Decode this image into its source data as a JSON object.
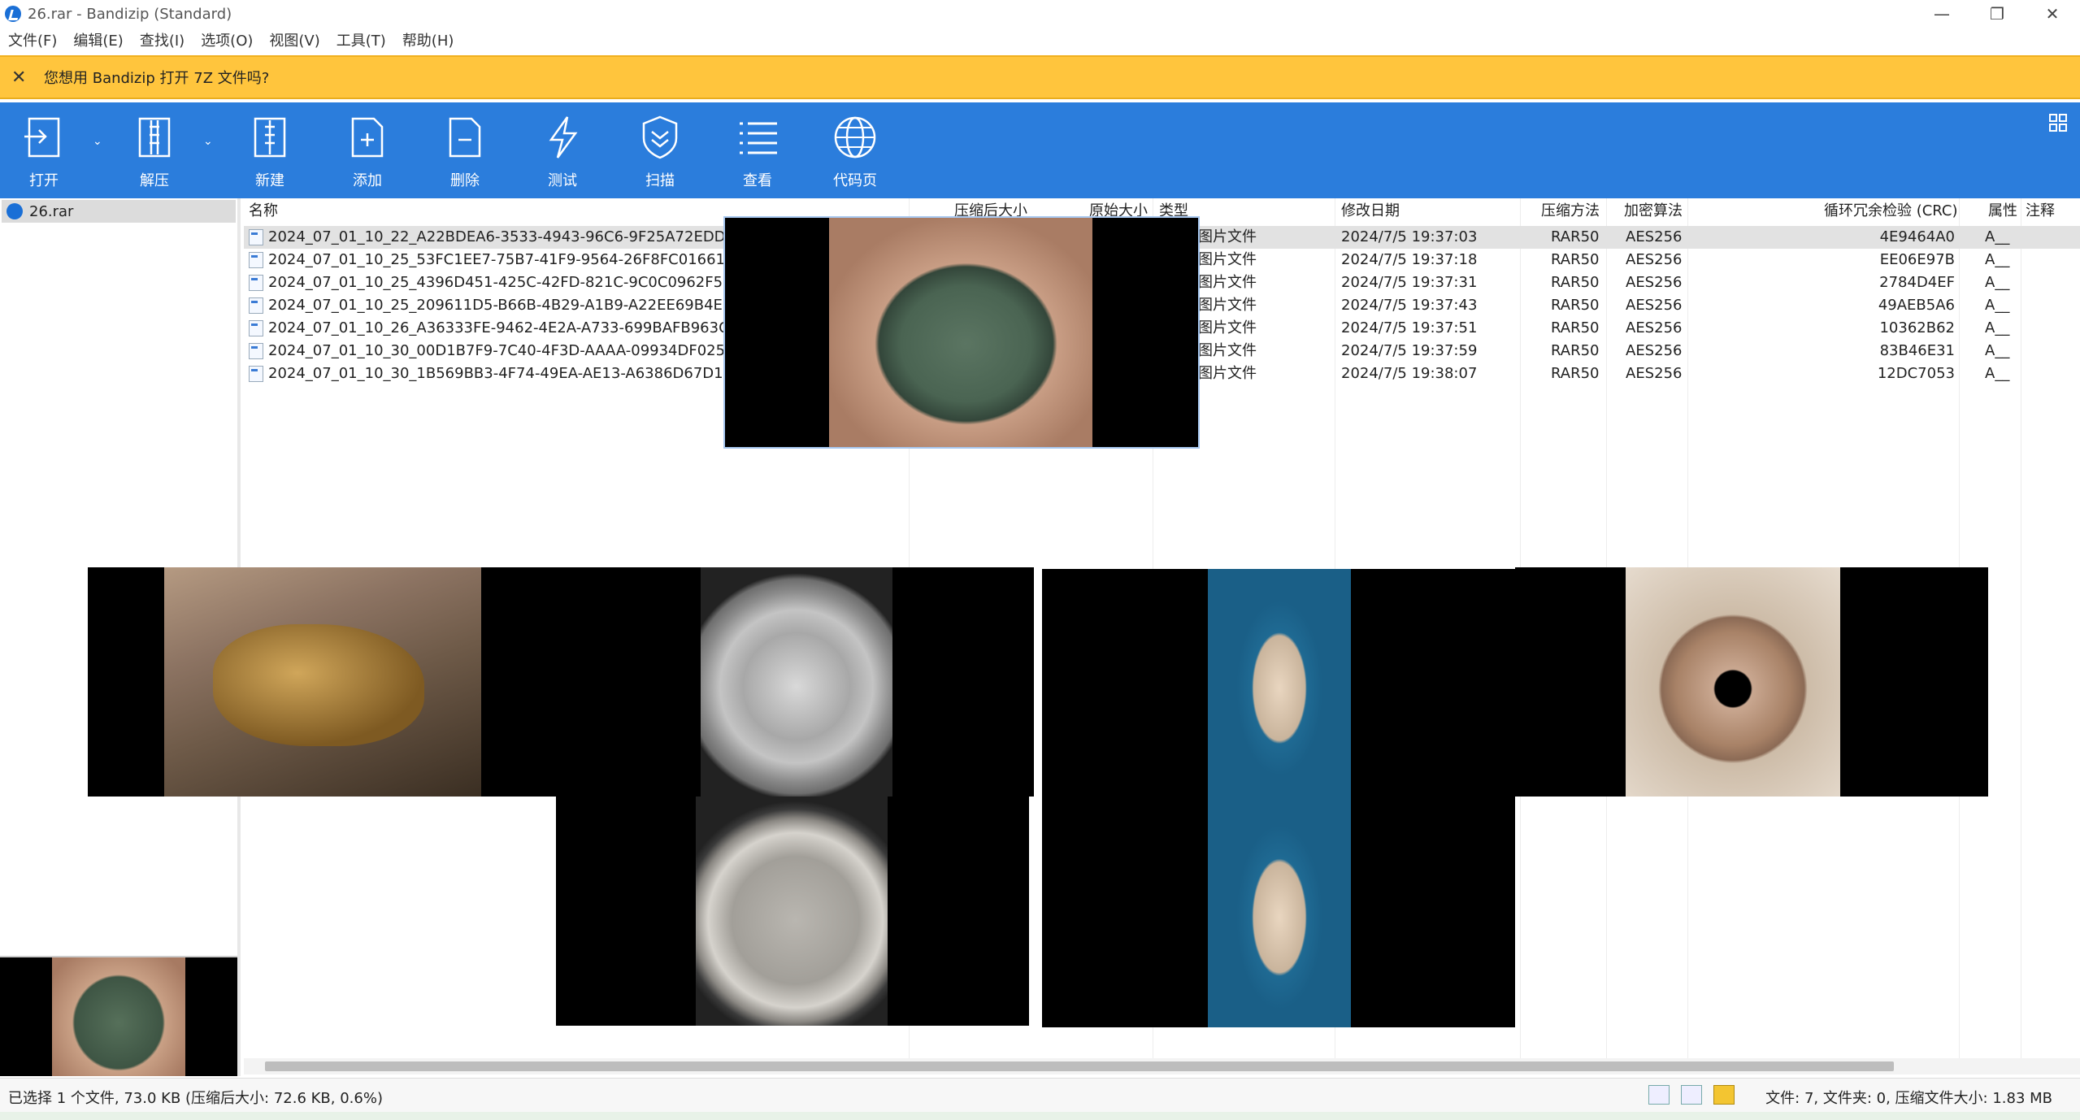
{
  "window": {
    "title": "26.rar - Bandizip (Standard)",
    "minimize": "—",
    "maximize": "❐",
    "close": "✕"
  },
  "menu": [
    "文件(F)",
    "编辑(E)",
    "查找(I)",
    "选项(O)",
    "视图(V)",
    "工具(T)",
    "帮助(H)"
  ],
  "notification": {
    "close": "✕",
    "text": "您想用 Bandizip 打开 7Z 文件吗?"
  },
  "toolbar": [
    {
      "label": "打开",
      "icon": "open-icon"
    },
    {
      "label": "解压",
      "icon": "extract-icon"
    },
    {
      "label": "新建",
      "icon": "new-archive-icon"
    },
    {
      "label": "添加",
      "icon": "add-file-icon"
    },
    {
      "label": "删除",
      "icon": "delete-file-icon"
    },
    {
      "label": "测试",
      "icon": "test-lightning-icon"
    },
    {
      "label": "扫描",
      "icon": "scan-shield-icon"
    },
    {
      "label": "查看",
      "icon": "view-list-icon"
    },
    {
      "label": "代码页",
      "icon": "codepage-globe-icon"
    }
  ],
  "tree": {
    "root": "26.rar"
  },
  "columns": [
    "名称",
    "压缩后大小",
    "原始大小",
    "类型",
    "修改日期",
    "压缩方法",
    "加密算法",
    "循环冗余检验 (CRC)",
    "属性",
    "注释"
  ],
  "files": [
    {
      "name": "2024_07_01_10_22_A22BDEA6-3533-4943-96C6-9F25A72EDDE",
      "type": "图片文件",
      "date": "2024/7/5 19:37:03",
      "method": "RAR50",
      "enc": "AES256",
      "crc": "4E9464A0",
      "attr": "A__"
    },
    {
      "name": "2024_07_01_10_25_53FC1EE7-75B7-41F9-9564-26F8FC01661C.",
      "type": "图片文件",
      "date": "2024/7/5 19:37:18",
      "method": "RAR50",
      "enc": "AES256",
      "crc": "EE06E97B",
      "attr": "A__"
    },
    {
      "name": "2024_07_01_10_25_4396D451-425C-42FD-821C-9C0C0962F566",
      "type": "图片文件",
      "date": "2024/7/5 19:37:31",
      "method": "RAR50",
      "enc": "AES256",
      "crc": "2784D4EF",
      "attr": "A__"
    },
    {
      "name": "2024_07_01_10_25_209611D5-B66B-4B29-A1B9-A22EE69B4E16",
      "type": "图片文件",
      "date": "2024/7/5 19:37:43",
      "method": "RAR50",
      "enc": "AES256",
      "crc": "49AEB5A6",
      "attr": "A__"
    },
    {
      "name": "2024_07_01_10_26_A36333FE-9462-4E2A-A733-699BAFB963C3",
      "type": "图片文件",
      "date": "2024/7/5 19:37:51",
      "method": "RAR50",
      "enc": "AES256",
      "crc": "10362B62",
      "attr": "A__"
    },
    {
      "name": "2024_07_01_10_30_00D1B7F9-7C40-4F3D-AAAA-09934DF0256",
      "type": "图片文件",
      "date": "2024/7/5 19:37:59",
      "method": "RAR50",
      "enc": "AES256",
      "crc": "83B46E31",
      "attr": "A__"
    },
    {
      "name": "2024_07_01_10_30_1B569BB3-4F74-49EA-AE13-A6386D67D16F",
      "type": "图片文件",
      "date": "2024/7/5 19:38:07",
      "method": "RAR50",
      "enc": "AES256",
      "crc": "12DC7053",
      "attr": "A__"
    }
  ],
  "status": {
    "left": "已选择 1 个文件, 73.0 KB (压缩后大小: 72.6 KB, 0.6%)",
    "right": "文件: 7, 文件夹: 0, 压缩文件大小: 1.83 MB"
  },
  "colors": {
    "toolbar": "#2b7ddc",
    "notification": "#ffc53d",
    "selected_row": "#e2e2e2"
  }
}
